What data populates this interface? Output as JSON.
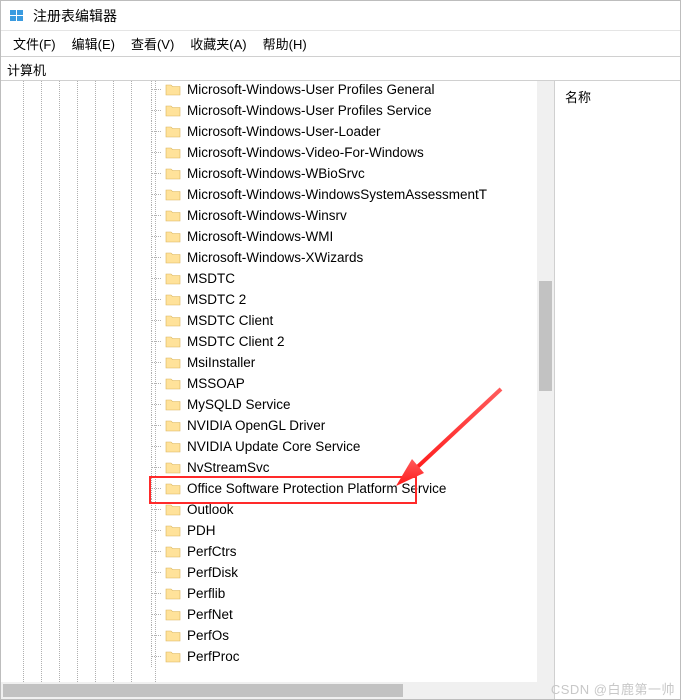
{
  "window": {
    "title": "注册表编辑器"
  },
  "menu": {
    "file": "文件(F)",
    "edit": "编辑(E)",
    "view": "查看(V)",
    "favorites": "收藏夹(A)",
    "help": "帮助(H)"
  },
  "address": {
    "path": "计算机"
  },
  "list": {
    "column_name": "名称"
  },
  "highlight_index": 15,
  "tree": {
    "items": [
      "Microsoft-Windows-User Profiles General",
      "Microsoft-Windows-User Profiles Service",
      "Microsoft-Windows-User-Loader",
      "Microsoft-Windows-Video-For-Windows",
      "Microsoft-Windows-WBioSrvc",
      "Microsoft-Windows-WindowsSystemAssessmentT",
      "Microsoft-Windows-Winsrv",
      "Microsoft-Windows-WMI",
      "Microsoft-Windows-XWizards",
      "MSDTC",
      "MSDTC 2",
      "MSDTC Client",
      "MSDTC Client 2",
      "MsiInstaller",
      "MSSOAP",
      "MySQLD Service",
      "NVIDIA OpenGL Driver",
      "NVIDIA Update Core Service",
      "NvStreamSvc",
      "Office Software Protection Platform Service",
      "Outlook",
      "PDH",
      "PerfCtrs",
      "PerfDisk",
      "Perflib",
      "PerfNet",
      "PerfOs",
      "PerfProc"
    ]
  },
  "watermark": "CSDN @白鹿第一帅"
}
